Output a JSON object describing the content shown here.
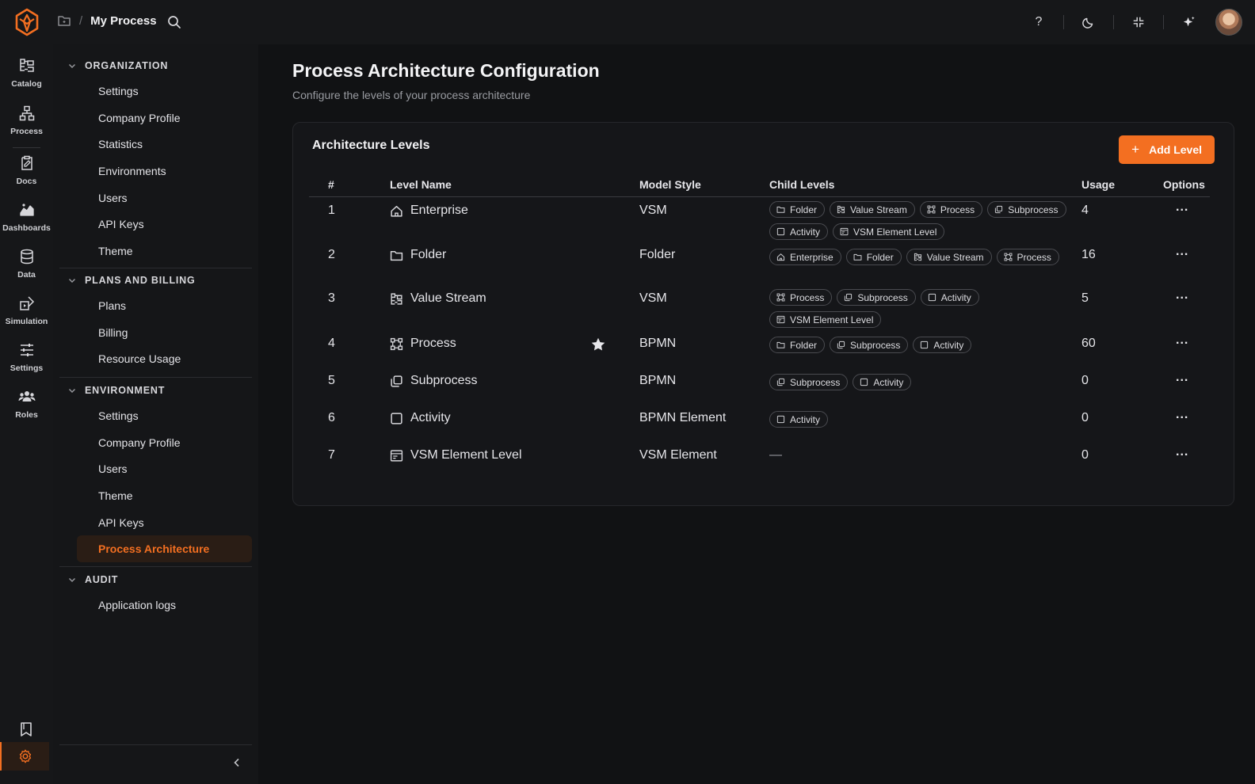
{
  "topbar": {
    "breadcrumb_separator": "/",
    "title": "My Process",
    "help_label": "?"
  },
  "rail": {
    "items": [
      {
        "label": "Catalog",
        "icon": "catalog-icon"
      },
      {
        "label": "Process",
        "icon": "process-icon"
      },
      {
        "label": "Docs",
        "icon": "docs-icon"
      },
      {
        "label": "Dashboards",
        "icon": "dashboards-icon"
      },
      {
        "label": "Data",
        "icon": "database-icon"
      },
      {
        "label": "Simulation",
        "icon": "simulation-icon"
      },
      {
        "label": "Settings",
        "icon": "sliders-icon"
      },
      {
        "label": "Roles",
        "icon": "users-icon"
      }
    ]
  },
  "nav": {
    "sections": [
      {
        "title": "ORGANIZATION",
        "items": [
          "Settings",
          "Company Profile",
          "Statistics",
          "Environments",
          "Users",
          "API Keys",
          "Theme"
        ]
      },
      {
        "title": "PLANS AND BILLING",
        "items": [
          "Plans",
          "Billing",
          "Resource Usage"
        ]
      },
      {
        "title": "ENVIRONMENT",
        "items": [
          "Settings",
          "Company Profile",
          "Users",
          "Theme",
          "API Keys",
          "Process Architecture"
        ],
        "active": "Process Architecture"
      },
      {
        "title": "AUDIT",
        "items": [
          "Application logs"
        ]
      }
    ]
  },
  "page": {
    "title": "Process Architecture Configuration",
    "subtitle": "Configure the levels of your process architecture"
  },
  "card": {
    "title": "Architecture Levels",
    "add_button": "Add Level",
    "add_button_icon": "+",
    "columns": {
      "num": "#",
      "name": "Level Name",
      "style": "Model Style",
      "children": "Child Levels",
      "usage": "Usage",
      "options": "Options"
    },
    "options_glyph": "...",
    "empty_children": "—",
    "rows": [
      {
        "num": "1",
        "name": "Enterprise",
        "icon": "home",
        "style": "VSM",
        "usage": "4",
        "default": false,
        "children": [
          {
            "label": "Folder",
            "icon": "folder"
          },
          {
            "label": "Value Stream",
            "icon": "stream"
          },
          {
            "label": "Process",
            "icon": "process"
          },
          {
            "label": "Subprocess",
            "icon": "subprocess"
          },
          {
            "label": "Activity",
            "icon": "activity"
          },
          {
            "label": "VSM Element Level",
            "icon": "vsm"
          }
        ]
      },
      {
        "num": "2",
        "name": "Folder",
        "icon": "folder",
        "style": "Folder",
        "usage": "16",
        "default": false,
        "children": [
          {
            "label": "Enterprise",
            "icon": "home"
          },
          {
            "label": "Folder",
            "icon": "folder"
          },
          {
            "label": "Value Stream",
            "icon": "stream"
          },
          {
            "label": "Process",
            "icon": "process"
          }
        ]
      },
      {
        "num": "3",
        "name": "Value Stream",
        "icon": "stream",
        "style": "VSM",
        "usage": "5",
        "default": false,
        "children": [
          {
            "label": "Process",
            "icon": "process"
          },
          {
            "label": "Subprocess",
            "icon": "subprocess"
          },
          {
            "label": "Activity",
            "icon": "activity"
          },
          {
            "label": "VSM Element Level",
            "icon": "vsm"
          }
        ]
      },
      {
        "num": "4",
        "name": "Process",
        "icon": "process",
        "style": "BPMN",
        "usage": "60",
        "default": true,
        "children": [
          {
            "label": "Folder",
            "icon": "folder"
          },
          {
            "label": "Subprocess",
            "icon": "subprocess"
          },
          {
            "label": "Activity",
            "icon": "activity"
          }
        ]
      },
      {
        "num": "5",
        "name": "Subprocess",
        "icon": "subprocess",
        "style": "BPMN",
        "usage": "0",
        "default": false,
        "children": [
          {
            "label": "Subprocess",
            "icon": "subprocess"
          },
          {
            "label": "Activity",
            "icon": "activity"
          }
        ]
      },
      {
        "num": "6",
        "name": "Activity",
        "icon": "activity",
        "style": "BPMN Element",
        "usage": "0",
        "default": false,
        "children": [
          {
            "label": "Activity",
            "icon": "activity"
          }
        ]
      },
      {
        "num": "7",
        "name": "VSM Element Level",
        "icon": "vsm",
        "style": "VSM Element",
        "usage": "0",
        "default": false,
        "children": []
      }
    ]
  },
  "colors": {
    "accent": "#f36f21",
    "background": "#111214",
    "panel": "#151619"
  }
}
